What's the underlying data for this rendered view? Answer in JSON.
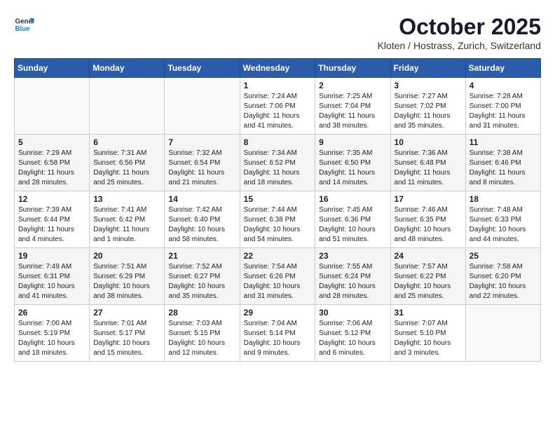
{
  "header": {
    "logo_line1": "General",
    "logo_line2": "Blue",
    "month_title": "October 2025",
    "location": "Kloten / Hostrass, Zurich, Switzerland"
  },
  "days_of_week": [
    "Sunday",
    "Monday",
    "Tuesday",
    "Wednesday",
    "Thursday",
    "Friday",
    "Saturday"
  ],
  "weeks": [
    [
      {
        "day": "",
        "info": ""
      },
      {
        "day": "",
        "info": ""
      },
      {
        "day": "",
        "info": ""
      },
      {
        "day": "1",
        "info": "Sunrise: 7:24 AM\nSunset: 7:06 PM\nDaylight: 11 hours\nand 41 minutes."
      },
      {
        "day": "2",
        "info": "Sunrise: 7:25 AM\nSunset: 7:04 PM\nDaylight: 11 hours\nand 38 minutes."
      },
      {
        "day": "3",
        "info": "Sunrise: 7:27 AM\nSunset: 7:02 PM\nDaylight: 11 hours\nand 35 minutes."
      },
      {
        "day": "4",
        "info": "Sunrise: 7:28 AM\nSunset: 7:00 PM\nDaylight: 11 hours\nand 31 minutes."
      }
    ],
    [
      {
        "day": "5",
        "info": "Sunrise: 7:29 AM\nSunset: 6:58 PM\nDaylight: 11 hours\nand 28 minutes."
      },
      {
        "day": "6",
        "info": "Sunrise: 7:31 AM\nSunset: 6:56 PM\nDaylight: 11 hours\nand 25 minutes."
      },
      {
        "day": "7",
        "info": "Sunrise: 7:32 AM\nSunset: 6:54 PM\nDaylight: 11 hours\nand 21 minutes."
      },
      {
        "day": "8",
        "info": "Sunrise: 7:34 AM\nSunset: 6:52 PM\nDaylight: 11 hours\nand 18 minutes."
      },
      {
        "day": "9",
        "info": "Sunrise: 7:35 AM\nSunset: 6:50 PM\nDaylight: 11 hours\nand 14 minutes."
      },
      {
        "day": "10",
        "info": "Sunrise: 7:36 AM\nSunset: 6:48 PM\nDaylight: 11 hours\nand 11 minutes."
      },
      {
        "day": "11",
        "info": "Sunrise: 7:38 AM\nSunset: 6:46 PM\nDaylight: 11 hours\nand 8 minutes."
      }
    ],
    [
      {
        "day": "12",
        "info": "Sunrise: 7:39 AM\nSunset: 6:44 PM\nDaylight: 11 hours\nand 4 minutes."
      },
      {
        "day": "13",
        "info": "Sunrise: 7:41 AM\nSunset: 6:42 PM\nDaylight: 11 hours\nand 1 minute."
      },
      {
        "day": "14",
        "info": "Sunrise: 7:42 AM\nSunset: 6:40 PM\nDaylight: 10 hours\nand 58 minutes."
      },
      {
        "day": "15",
        "info": "Sunrise: 7:44 AM\nSunset: 6:38 PM\nDaylight: 10 hours\nand 54 minutes."
      },
      {
        "day": "16",
        "info": "Sunrise: 7:45 AM\nSunset: 6:36 PM\nDaylight: 10 hours\nand 51 minutes."
      },
      {
        "day": "17",
        "info": "Sunrise: 7:46 AM\nSunset: 6:35 PM\nDaylight: 10 hours\nand 48 minutes."
      },
      {
        "day": "18",
        "info": "Sunrise: 7:48 AM\nSunset: 6:33 PM\nDaylight: 10 hours\nand 44 minutes."
      }
    ],
    [
      {
        "day": "19",
        "info": "Sunrise: 7:49 AM\nSunset: 6:31 PM\nDaylight: 10 hours\nand 41 minutes."
      },
      {
        "day": "20",
        "info": "Sunrise: 7:51 AM\nSunset: 6:29 PM\nDaylight: 10 hours\nand 38 minutes."
      },
      {
        "day": "21",
        "info": "Sunrise: 7:52 AM\nSunset: 6:27 PM\nDaylight: 10 hours\nand 35 minutes."
      },
      {
        "day": "22",
        "info": "Sunrise: 7:54 AM\nSunset: 6:26 PM\nDaylight: 10 hours\nand 31 minutes."
      },
      {
        "day": "23",
        "info": "Sunrise: 7:55 AM\nSunset: 6:24 PM\nDaylight: 10 hours\nand 28 minutes."
      },
      {
        "day": "24",
        "info": "Sunrise: 7:57 AM\nSunset: 6:22 PM\nDaylight: 10 hours\nand 25 minutes."
      },
      {
        "day": "25",
        "info": "Sunrise: 7:58 AM\nSunset: 6:20 PM\nDaylight: 10 hours\nand 22 minutes."
      }
    ],
    [
      {
        "day": "26",
        "info": "Sunrise: 7:00 AM\nSunset: 5:19 PM\nDaylight: 10 hours\nand 18 minutes."
      },
      {
        "day": "27",
        "info": "Sunrise: 7:01 AM\nSunset: 5:17 PM\nDaylight: 10 hours\nand 15 minutes."
      },
      {
        "day": "28",
        "info": "Sunrise: 7:03 AM\nSunset: 5:15 PM\nDaylight: 10 hours\nand 12 minutes."
      },
      {
        "day": "29",
        "info": "Sunrise: 7:04 AM\nSunset: 5:14 PM\nDaylight: 10 hours\nand 9 minutes."
      },
      {
        "day": "30",
        "info": "Sunrise: 7:06 AM\nSunset: 5:12 PM\nDaylight: 10 hours\nand 6 minutes."
      },
      {
        "day": "31",
        "info": "Sunrise: 7:07 AM\nSunset: 5:10 PM\nDaylight: 10 hours\nand 3 minutes."
      },
      {
        "day": "",
        "info": ""
      }
    ]
  ]
}
